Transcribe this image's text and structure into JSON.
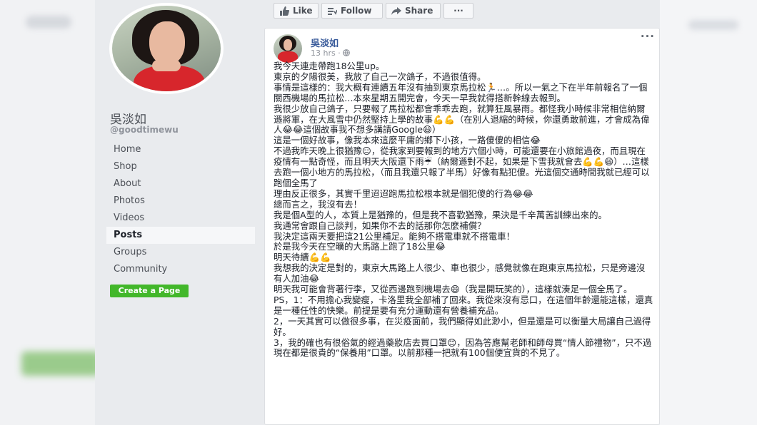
{
  "profile": {
    "name": "吳淡如",
    "handle": "@goodtimewu",
    "nav": [
      "Home",
      "Shop",
      "About",
      "Photos",
      "Videos",
      "Posts",
      "Groups",
      "Community"
    ],
    "active_nav": "Posts",
    "create_page": "Create a Page"
  },
  "actions": {
    "like": "Like",
    "follow": "Follow",
    "share": "Share",
    "more": "···"
  },
  "post": {
    "author": "吳淡如",
    "time": "13 hrs · ",
    "more": "···",
    "paragraphs": [
      "我今天連走帶跑18公里up。",
      "東京的夕陽很美，我放了自己一次鴿子，不過很值得。",
      "事情是這樣的：我大概有連續五年沒有抽到東京馬拉松🏃…。所以一氣之下在半年前報名了一個關西機場的馬拉松…本來星期五開完會，今天一早我就得搭新幹線去報到。",
      "我很少放自己鴿子，只要報了馬拉松都會乖乖去跑，就算狂風暴雨。都怪我小時候非常相信納爾遜將軍，在大風雪中仍然堅持上學的故事💪💪（在別人退縮的時候，你還勇敢前進，才會成為偉人😂😂這個故事我不想多講請Google😄）",
      "這是一個好故事，像我本來這麼平庸的鄉下小孩，一路傻傻的相信😂",
      "不過我昨天晚上很猶豫😑，從我家到要報到的地方六個小時，可能還要在小旅館過夜，而且現在疫情有一點奇怪，而且明天大阪還下雨☔（納爾遜對不起，如果是下雪我就會去💪💪😄）…這樣去跑一個小地方的馬拉松，（而且我還只報了半馬）好像有點犯傻。光這個交通時間我就已經可以跑個全馬了",
      "理由反正很多，其實千里迢迢跑馬拉松根本就是個犯傻的行為😂😂",
      "總而言之，我沒有去！",
      "我是個A型的人，本質上是猶豫的，但是我不喜歡猶豫，果決是千辛萬苦訓練出來的。",
      "我通常會跟自己談判，如果你不去的話那你怎麼補償？",
      "我決定這兩天要把這21公里補足。能夠不搭電車就不搭電車！",
      "於是我今天在空曠的大馬路上跑了18公里😂",
      "明天待續💪💪",
      "我想我的決定是對的，東京大馬路上人很少、車也很少，感覺就像在跑東京馬拉松，只是旁邊沒有人加油😂",
      "明天我可能會背著行李，又從西邊跑到機場去😄（我是開玩笑的），這樣就湊足一個全馬了。",
      "PS，1：不用擔心我變瘦，卡洛里我全部補了回來。我從來沒有忌口，在這個年齡還能這樣，還真是一種任性的快樂。前提是要有充分運動還有營養補充品。",
      "2，一天其實可以做很多事，在災疫面前，我們顯得如此渺小，但是還是可以衡量大局讓自己過得好。",
      "3，我的確也有很俗氣的經過藥妝店去買口罩😊，因為答應幫老師和師母買“情人節禮物”，只不過現在都是很貴的“保養用”口罩。以前那種一把就有100個便宜貨的不見了。"
    ]
  }
}
